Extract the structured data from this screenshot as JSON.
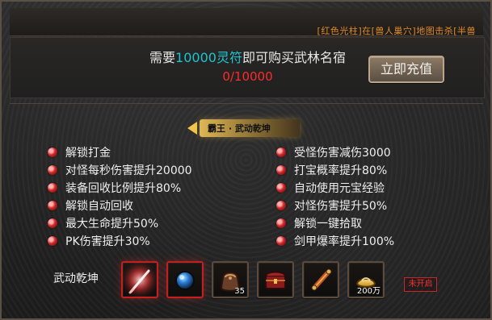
{
  "ticker_text": "[红色光柱]在[兽人巢穴]地图击杀[半兽",
  "header": {
    "prefix": "需要",
    "amount": "10000灵符",
    "suffix": "即可购买武林名宿",
    "progress": "0/10000",
    "recharge_button": "立即充值"
  },
  "section_title": "霸王 · 武动乾坤",
  "features_left": [
    "解锁打金",
    "对怪每秒伤害提升20000",
    "装备回收比例提升80%",
    "解锁自动回收",
    "最大生命提升50%",
    "PK伤害提升30%"
  ],
  "features_right": [
    "受怪伤害减伤3000",
    "打宝概率提升80%",
    "自动使用元宝经验",
    "对怪伤害提升50%",
    "解锁一键拾取",
    "剑甲爆率提升100%"
  ],
  "bottom": {
    "label": "武动乾坤",
    "items": [
      {
        "icon": "glowing-sword-icon",
        "count": ""
      },
      {
        "icon": "blue-orb-icon",
        "count": ""
      },
      {
        "icon": "pouch-icon",
        "count": "35"
      },
      {
        "icon": "treasure-chest-icon",
        "count": ""
      },
      {
        "icon": "scroll-icon",
        "count": ""
      },
      {
        "icon": "gold-ingot-icon",
        "count": "200万"
      }
    ],
    "status": "未开启"
  },
  "colors": {
    "accent_cyan": "#18c6d2",
    "progress_red": "#ff2a2a",
    "ticker_orange": "#e08a2a",
    "banner_gold": "#f0c44b"
  }
}
